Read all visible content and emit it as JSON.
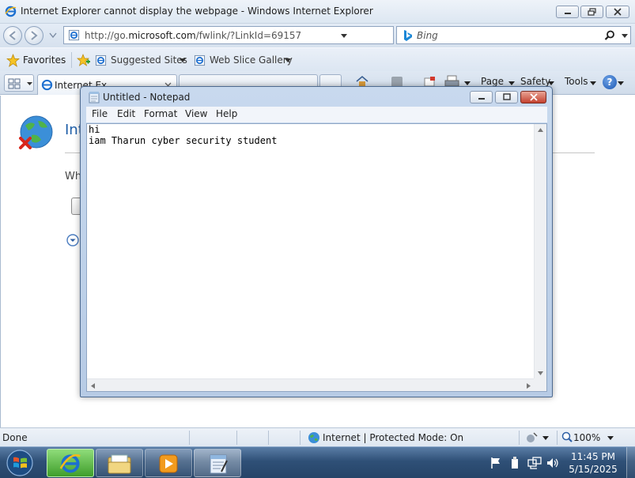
{
  "ie": {
    "window_title": "Internet Explorer cannot display the webpage - Windows Internet Explorer",
    "address_prefix": "http://go.",
    "address_domain": "microsoft.com",
    "address_suffix": "/fwlink/?LinkId=69157",
    "search_placeholder": "Bing",
    "favorites_label": "Favorites",
    "suggested_sites_label": "Suggested Sites",
    "web_slice_gallery_label": "Web Slice Gallery",
    "tab1_label": "Internet Ex",
    "commands": {
      "page": "Page",
      "safety": "Safety",
      "tools": "Tools"
    },
    "content": {
      "title_partial": "Int",
      "body_partial": "Wh"
    },
    "status": {
      "left": "Done",
      "zone": "Internet | Protected Mode: On",
      "zoom": "100%"
    }
  },
  "notepad": {
    "title": "Untitled - Notepad",
    "menu": [
      "File",
      "Edit",
      "Format",
      "View",
      "Help"
    ],
    "text": "hi\niam Tharun cyber security student"
  },
  "taskbar": {
    "time": "11:45 PM",
    "date": "5/15/2025"
  },
  "colors": {
    "accent": "#1f5fa8",
    "taskbar": "#2f5077",
    "ie_active": "#3f9e2b"
  }
}
